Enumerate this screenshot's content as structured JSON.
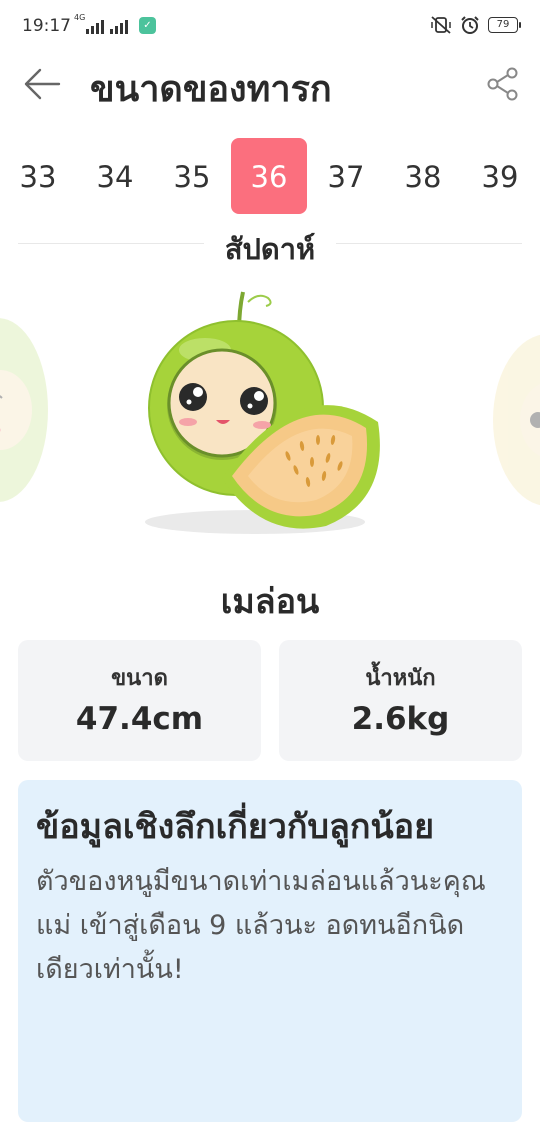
{
  "status_bar": {
    "time": "19:17",
    "network": "4G",
    "battery": "79"
  },
  "header": {
    "title": "ขนาดของทารก",
    "back_icon": "arrow-left-icon",
    "share_icon": "share-icon"
  },
  "weeks": {
    "items": [
      "33",
      "34",
      "35",
      "36",
      "37",
      "38",
      "39"
    ],
    "selected": "36",
    "caption": "สัปดาห์"
  },
  "fruit": {
    "name": "เมล่อน"
  },
  "stats": {
    "size_label": "ขนาด",
    "size_value": "47.4cm",
    "weight_label": "น้ำหนัก",
    "weight_value": "2.6kg"
  },
  "info": {
    "title": "ข้อมูลเชิงลึกเกี่ยวกับลูกน้อย",
    "body": "ตัวของหนูมีขนาดเท่าเมล่อนแล้วนะคุณแม่ เข้าสู่เดือน 9 แล้วนะ อดทนอีกนิดเดียวเท่านั้น!"
  },
  "colors": {
    "accent": "#fb6f7e",
    "card_bg": "#f3f4f6",
    "info_bg": "#e3f1fc",
    "melon_green": "#a6d33a",
    "melon_flesh": "#f6c987"
  }
}
